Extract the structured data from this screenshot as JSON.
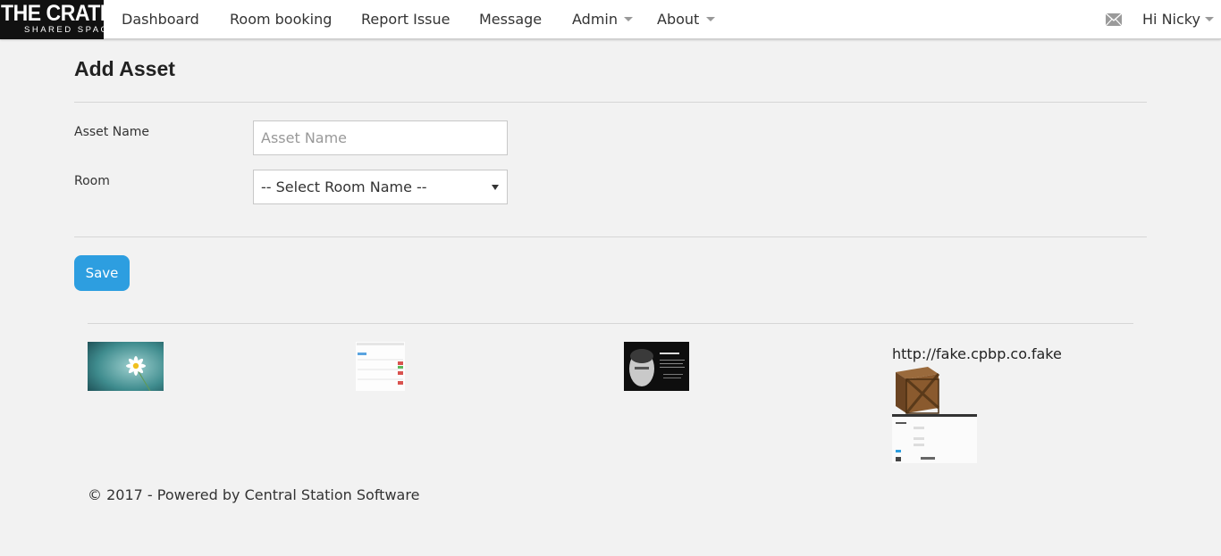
{
  "brand": {
    "logo_main": "THE CRATE",
    "logo_sub": "SHARED SPACE"
  },
  "nav": {
    "items": [
      {
        "label": "Dashboard"
      },
      {
        "label": "Room booking"
      },
      {
        "label": "Report Issue"
      },
      {
        "label": "Message"
      },
      {
        "label": "Admin"
      },
      {
        "label": "About"
      }
    ],
    "mail_icon": "envelope-icon",
    "user_greeting": "Hi Nicky"
  },
  "page": {
    "title": "Add Asset"
  },
  "form": {
    "asset_name_label": "Asset Name",
    "asset_name_placeholder": "Asset Name",
    "asset_name_value": "",
    "room_label": "Room",
    "room_selected": "-- Select Room Name --",
    "save_label": "Save"
  },
  "gallery": {
    "url_text": "http://fake.cpbp.co.fake",
    "images": [
      "daisy-photo",
      "spreadsheet-screenshot",
      "portrait-quote-photo",
      "wooden-crate-image",
      "form-screenshot"
    ]
  },
  "footer": {
    "text": "© 2017 - Powered by Central Station Software"
  },
  "colors": {
    "primary_button": "#2d9ee0",
    "navbar_bg": "#ffffff",
    "page_bg": "#f2f2f2",
    "logo_bg": "#111111"
  }
}
